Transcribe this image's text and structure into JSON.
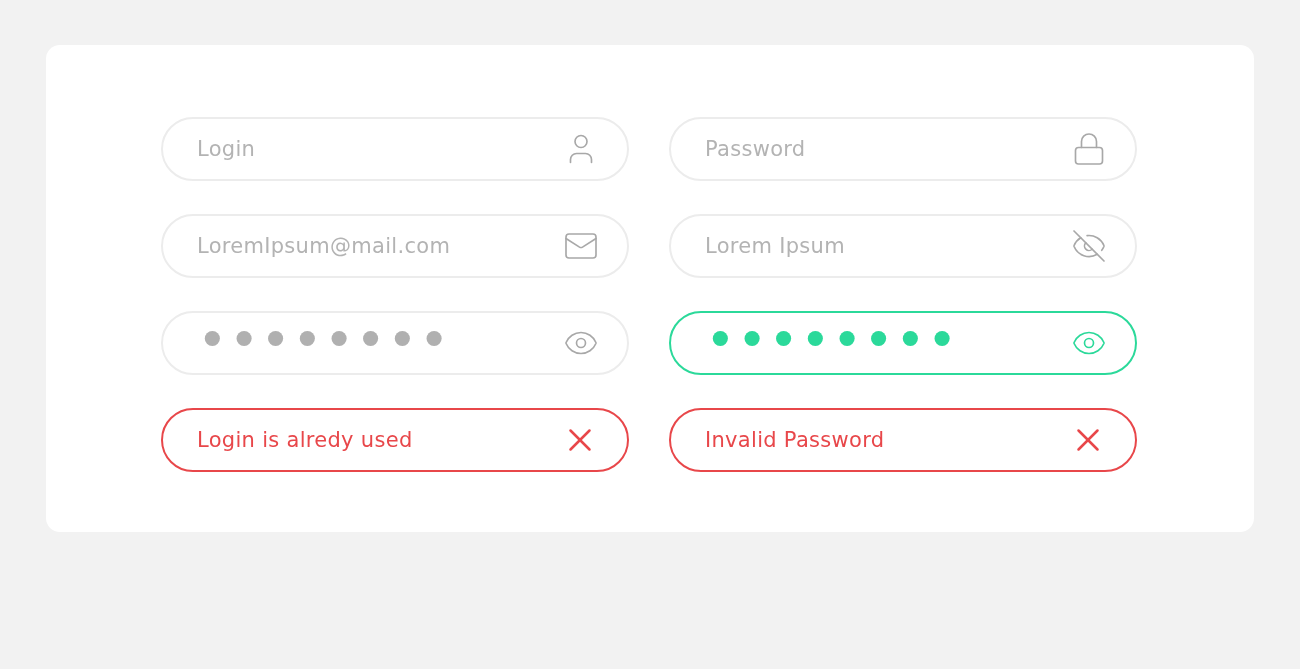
{
  "fields": [
    {
      "kind": "user",
      "placeholder": "Login",
      "valid": false
    },
    {
      "kind": "lock",
      "placeholder": "Password",
      "valid": false
    },
    {
      "kind": "mail",
      "placeholder": "LoremIpsum@mail.com",
      "valid": false
    },
    {
      "kind": "hidden",
      "placeholder": "Lorem Ipsum",
      "valid": false
    },
    {
      "kind": "secret",
      "value": "••••••••",
      "valid": false
    },
    {
      "kind": "secret",
      "value": "••••••••",
      "valid": true
    },
    {
      "kind": "error",
      "value": "Login is alredy used",
      "valid": false
    },
    {
      "kind": "error",
      "value": "Invalid Password",
      "valid": false
    }
  ]
}
